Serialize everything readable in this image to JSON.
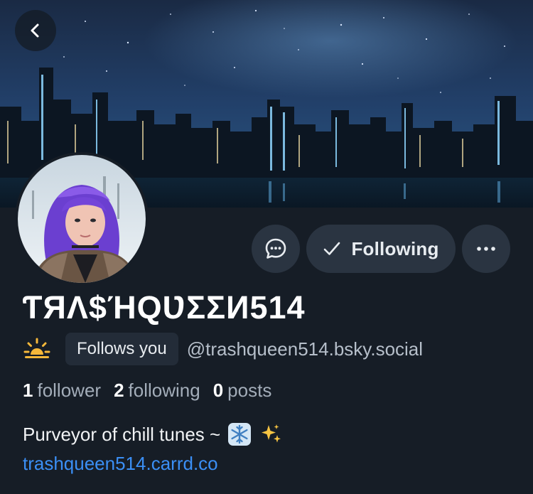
{
  "profile": {
    "display_name": "ƬЯΛ$ΉQƲΣΣИ514",
    "follows_you_label": "Follows you",
    "handle": "@trashqueen514.bsky.social",
    "stats": {
      "followers_count": "1",
      "followers_label": "follower",
      "following_count": "2",
      "following_label": "following",
      "posts_count": "0",
      "posts_label": "posts"
    },
    "bio": "Purveyor of chill tunes ~",
    "bio_emojis": [
      "snowflake-icon",
      "sparkles-icon"
    ],
    "link": "trashqueen514.carrd.co"
  },
  "actions": {
    "following_label": "Following"
  },
  "icons": {
    "back": "chevron-left-icon",
    "message": "message-bubble-icon",
    "following": "checkmark-icon",
    "more": "ellipsis-icon",
    "status": "sunrise-icon"
  },
  "colors": {
    "background": "#161d26",
    "button": "#2a3441",
    "link": "#3b8ff5",
    "secondary_text": "#a3adb9"
  }
}
